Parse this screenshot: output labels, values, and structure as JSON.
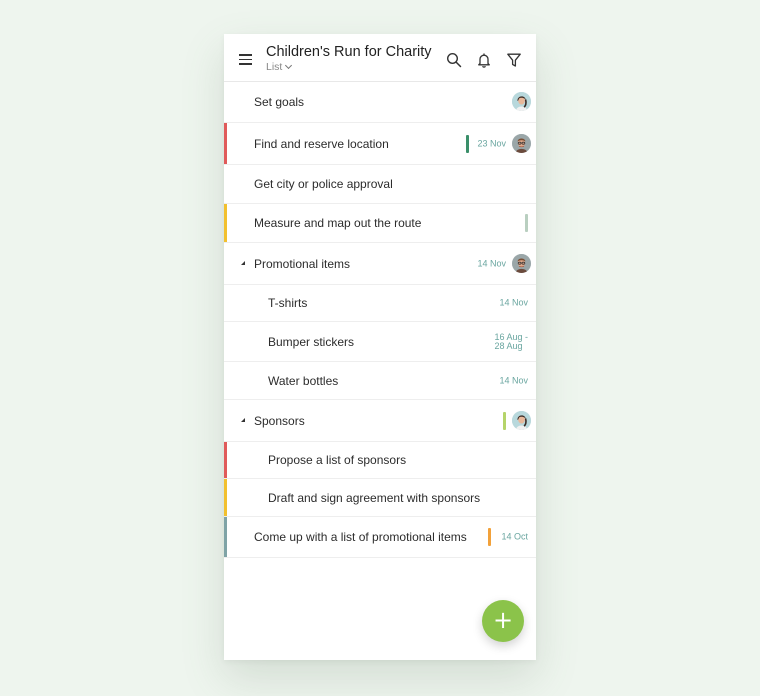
{
  "header": {
    "title": "Children's Run for Charity",
    "view": "List",
    "icons": [
      "menu-icon",
      "search-icon",
      "bell-icon",
      "filter-icon"
    ]
  },
  "tasks": [
    {
      "label": "Set goals",
      "level": 0,
      "stripe": "",
      "bar": "",
      "date": "",
      "avatar": "woman"
    },
    {
      "label": "Find and reserve location",
      "level": 0,
      "stripe": "#e05a5a",
      "bar": "#3a8f6a",
      "date": "23 Nov",
      "avatar": "man"
    },
    {
      "label": "Get city or police approval",
      "level": 0,
      "stripe": "",
      "bar": "",
      "date": "",
      "avatar": ""
    },
    {
      "label": "Measure and map out the route",
      "level": 0,
      "stripe": "#f2c02e",
      "bar": "#b9cfc0",
      "date": "",
      "avatar": ""
    },
    {
      "label": "Promotional items",
      "level": 0,
      "stripe": "",
      "bar": "",
      "date": "14 Nov",
      "avatar": "man",
      "group": true
    },
    {
      "label": "T-shirts",
      "level": 1,
      "stripe": "",
      "bar": "",
      "date": "14 Nov",
      "avatar": ""
    },
    {
      "label": "Bumper stickers",
      "level": 1,
      "stripe": "",
      "bar": "",
      "date": "16 Aug - 28 Aug",
      "date_line1": "16 Aug -",
      "date_line2": "28 Aug",
      "avatar": ""
    },
    {
      "label": "Water bottles",
      "level": 1,
      "stripe": "",
      "bar": "",
      "date": "14 Nov",
      "avatar": ""
    },
    {
      "label": "Sponsors",
      "level": 0,
      "stripe": "",
      "bar": "#b5d46a",
      "date": "",
      "avatar": "woman",
      "group": true
    },
    {
      "label": "Propose a list of sponsors",
      "level": 1,
      "stripe": "#e05a5a",
      "bar": "",
      "date": "",
      "avatar": ""
    },
    {
      "label": "Draft and sign agreement with sponsors",
      "level": 1,
      "stripe": "#f2c02e",
      "bar": "",
      "date": "",
      "avatar": ""
    },
    {
      "label": "Come up with a list of promotional items",
      "level": 0,
      "stripe": "#7fa3a6",
      "bar": "#f2a13a",
      "date": "14 Oct",
      "avatar": ""
    }
  ],
  "fab": {
    "label": "+",
    "color": "#8bc34a"
  }
}
